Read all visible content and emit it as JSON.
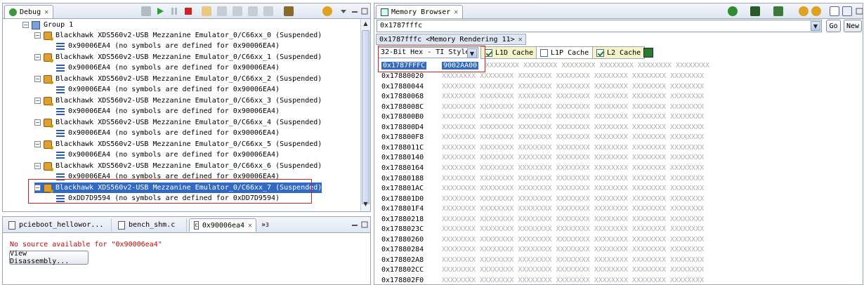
{
  "debug": {
    "tab_label": "Debug",
    "group_label": "Group 1",
    "rows": [
      {
        "target": "Blackhawk XDS560v2-USB Mezzanine Emulator_0/C66xx_0 (Suspended)",
        "frame": "0x90006EA4  (no symbols are defined for 0x90006EA4)"
      },
      {
        "target": "Blackhawk XDS560v2-USB Mezzanine Emulator_0/C66xx_1 (Suspended)",
        "frame": "0x90006EA4  (no symbols are defined for 0x90006EA4)"
      },
      {
        "target": "Blackhawk XDS560v2-USB Mezzanine Emulator_0/C66xx_2 (Suspended)",
        "frame": "0x90006EA4  (no symbols are defined for 0x90006EA4)"
      },
      {
        "target": "Blackhawk XDS560v2-USB Mezzanine Emulator_0/C66xx_3 (Suspended)",
        "frame": "0x90006EA4  (no symbols are defined for 0x90006EA4)"
      },
      {
        "target": "Blackhawk XDS560v2-USB Mezzanine Emulator_0/C66xx_4 (Suspended)",
        "frame": "0x90006EA4  (no symbols are defined for 0x90006EA4)"
      },
      {
        "target": "Blackhawk XDS560v2-USB Mezzanine Emulator_0/C66xx_5 (Suspended)",
        "frame": "0x90006EA4  (no symbols are defined for 0x90006EA4)"
      },
      {
        "target": "Blackhawk XDS560v2-USB Mezzanine Emulator_0/C66xx_6 (Suspended)",
        "frame": "0x90006EA4  (no symbols are defined for 0x90006EA4)"
      },
      {
        "target": "Blackhawk XDS560v2-USB Mezzanine Emulator_0/C66xx_7 (Suspended)",
        "frame": "0xDD7D9594  (no symbols are defined for 0xDD7D9594)"
      }
    ]
  },
  "editor": {
    "tabs": [
      "pcieboot_hellowor...",
      "bench_shm.c",
      "0x90006ea4"
    ],
    "overflow": "»",
    "overflow_count": "3",
    "message": "No source available for \"0x90006ea4\"",
    "button_label": "View Disassembly..."
  },
  "memory": {
    "tab_label": "Memory Browser",
    "address_value": "0x1787fffc",
    "go_label": "Go",
    "new_label": "New",
    "rendering_tab": "0x1787fffc <Memory Rendering 11>",
    "format": "32-Bit Hex - TI Style",
    "caches": [
      {
        "label": "L1D Cache",
        "checked": true
      },
      {
        "label": "L1P Cache",
        "checked": false
      },
      {
        "label": "L2 Cache",
        "checked": true
      }
    ],
    "first_addr": "0x1787FFFC",
    "first_value": "9002AA00",
    "first_rest": "XXXXXXXX XXXXXXXX XXXXXXXX XXXXXXXX XXXXXXXX XXXXXXXX",
    "rest_fill": "XXXXXXXX XXXXXXXX XXXXXXXX XXXXXXXX XXXXXXXX XXXXXXXX XXXXXXXX",
    "addresses": [
      "0x17880020",
      "0x17880044",
      "0x17880068",
      "0x1788008C",
      "0x178800B0",
      "0x178800D4",
      "0x178800F8",
      "0x1788011C",
      "0x17880140",
      "0x17880164",
      "0x17880188",
      "0x178801AC",
      "0x178801D0",
      "0x178801F4",
      "0x17880218",
      "0x1788023C",
      "0x17880260",
      "0x17880284",
      "0x178802A8",
      "0x178802CC",
      "0x178802F0"
    ]
  }
}
